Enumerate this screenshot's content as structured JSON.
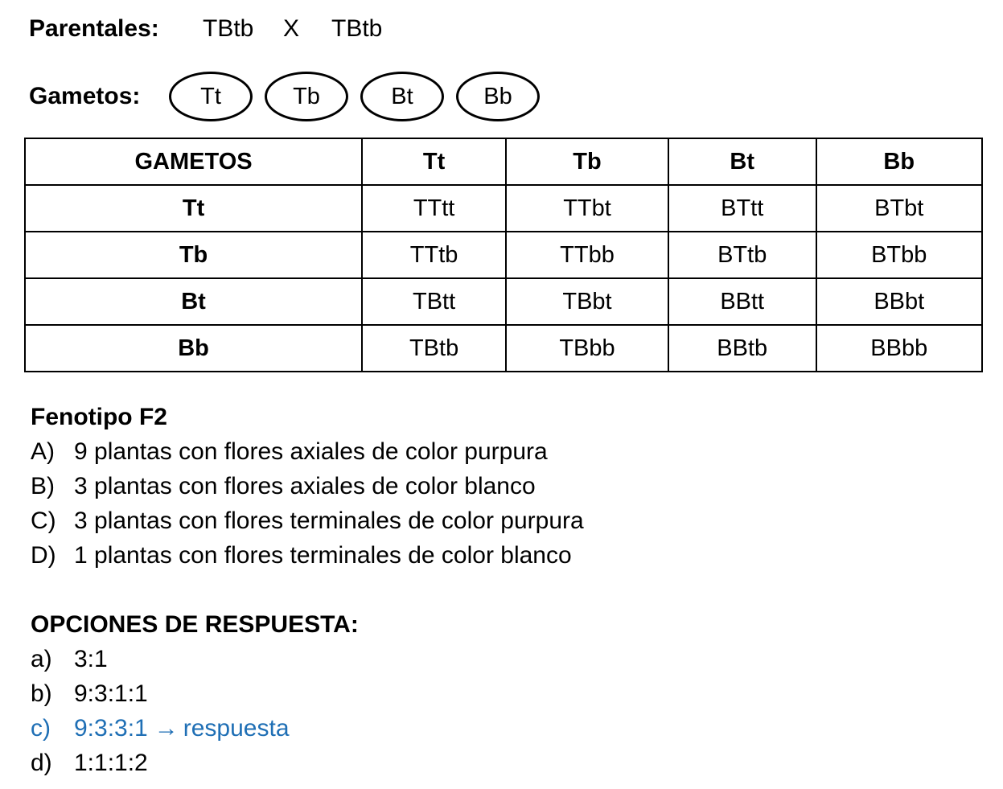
{
  "parentales": {
    "label": "Parentales:",
    "parent1": "TBtb",
    "cross": "X",
    "parent2": "TBtb"
  },
  "gametos": {
    "label": "Gametos:",
    "items": [
      "Tt",
      "Tb",
      "Bt",
      "Bb"
    ]
  },
  "table": {
    "corner": "GAMETOS",
    "col_headers": [
      "Tt",
      "Tb",
      "Bt",
      "Bb"
    ],
    "rows": [
      {
        "header": "Tt",
        "cells": [
          "TTtt",
          "TTbt",
          "BTtt",
          "BTbt"
        ]
      },
      {
        "header": "Tb",
        "cells": [
          "TTtb",
          "TTbb",
          "BTtb",
          "BTbb"
        ]
      },
      {
        "header": "Bt",
        "cells": [
          "TBtt",
          "TBbt",
          "BBtt",
          "BBbt"
        ]
      },
      {
        "header": "Bb",
        "cells": [
          "TBtb",
          "TBbb",
          "BBtb",
          "BBbb"
        ]
      }
    ]
  },
  "fenotipo": {
    "title": "Fenotipo F2",
    "items": [
      {
        "marker": "A)",
        "text": "9 plantas con flores axiales de color purpura"
      },
      {
        "marker": "B)",
        "text": "3 plantas con flores axiales de color blanco"
      },
      {
        "marker": "C)",
        "text": "3 plantas con flores terminales de color purpura"
      },
      {
        "marker": "D)",
        "text": "1 plantas con flores terminales de color blanco"
      }
    ]
  },
  "opciones": {
    "title": "OPCIONES DE RESPUESTA:",
    "items": [
      {
        "marker": "a)",
        "text": "3:1"
      },
      {
        "marker": "b)",
        "text": "9:3:1:1"
      },
      {
        "marker": "c)",
        "text": "9:3:3:1",
        "arrow": "→",
        "note": "respuesta"
      },
      {
        "marker": "d)",
        "text": "1:1:1:2"
      }
    ],
    "answer_color": "#1f6fb5"
  }
}
